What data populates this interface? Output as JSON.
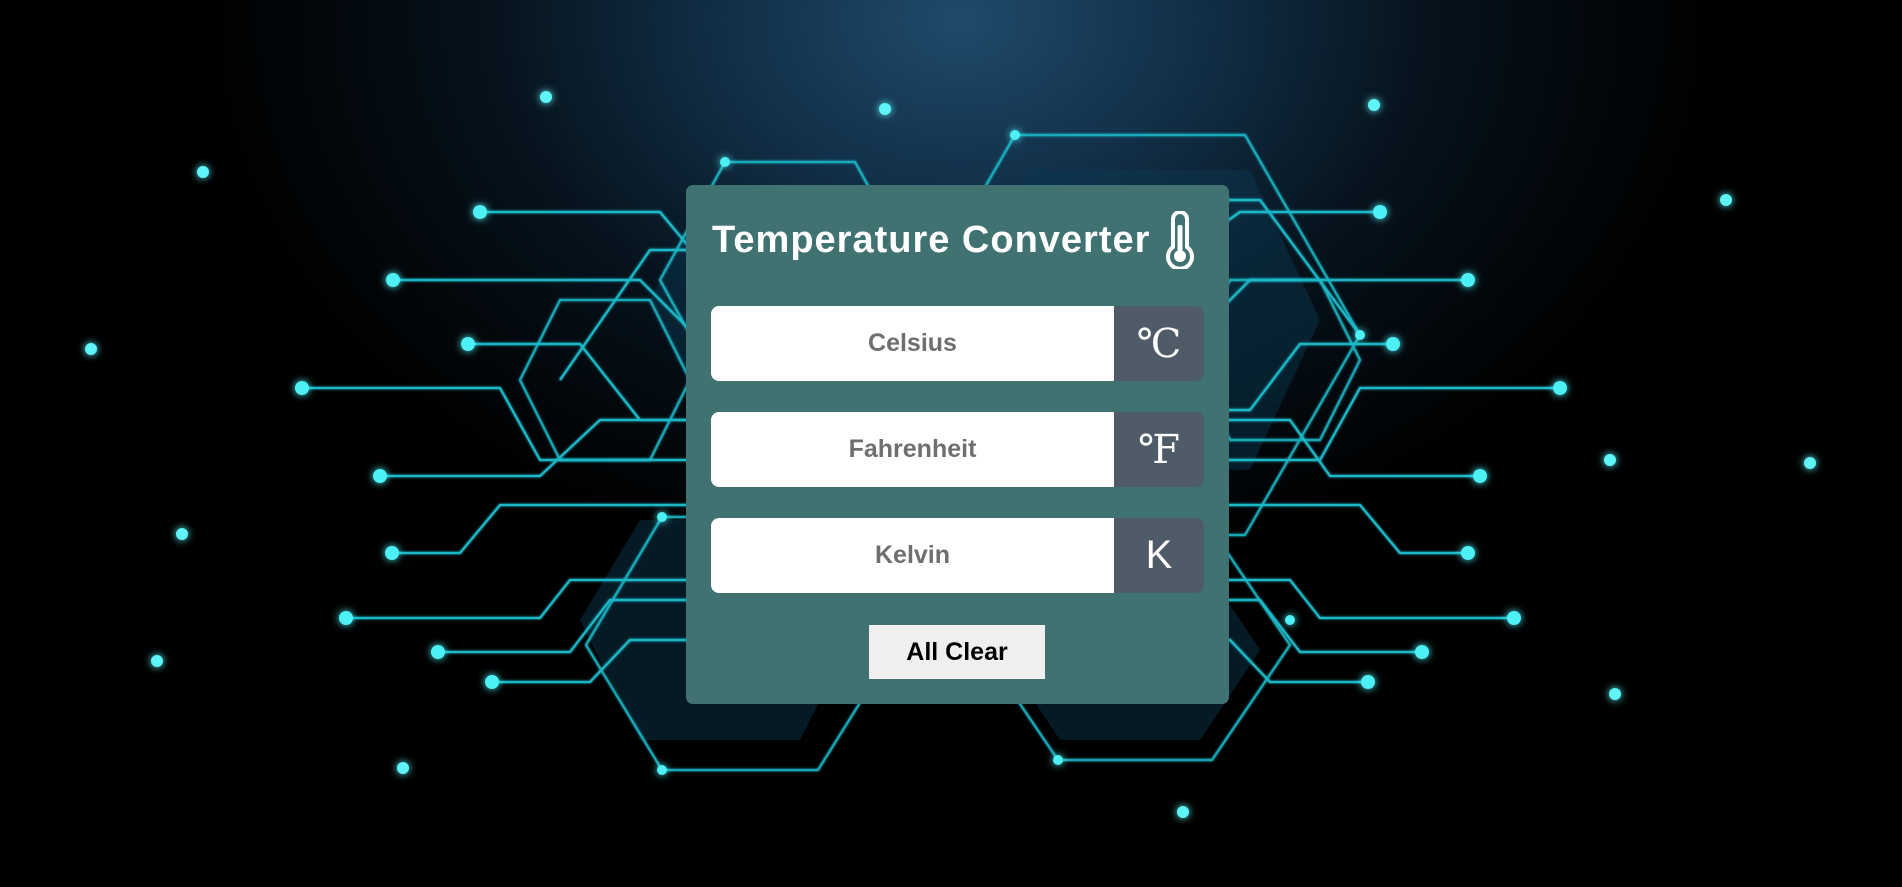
{
  "app": {
    "title": "Temperature Converter",
    "title_icon": "thermometer-icon"
  },
  "fields": [
    {
      "id": "celsius",
      "placeholder": "Celsius",
      "value": "",
      "unit": "℃"
    },
    {
      "id": "fahrenheit",
      "placeholder": "Fahrenheit",
      "value": "",
      "unit": "℉"
    },
    {
      "id": "kelvin",
      "placeholder": "Kelvin",
      "value": "",
      "unit": "K"
    }
  ],
  "actions": {
    "clear_label": "All Clear"
  },
  "colors": {
    "card_background": "#417272",
    "unit_background": "#4f5b66",
    "input_background": "#ffffff",
    "button_background": "#efefef",
    "circuit_line": "#1fb8c8",
    "glow_dot": "#4ef0f5"
  }
}
